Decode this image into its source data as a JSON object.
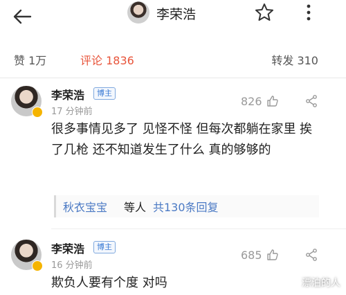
{
  "header": {
    "title": "李荣浩",
    "back_icon": "back-arrow-icon",
    "star_icon": "star-icon",
    "more_icon": "more-vertical-icon"
  },
  "stats": {
    "like_label": "赞 1万",
    "comment_label": "评论 1836",
    "repost_label": "转发 310"
  },
  "comments": [
    {
      "author": "李荣浩",
      "tag": "博主",
      "time": "17 分钟前",
      "likes": "826",
      "text": "很多事情见多了 见怪不怪 但每次都躺在家里 挨了几枪 还不知道发生了什么 真的够够的",
      "reply_user": "秋衣宝宝",
      "reply_mid": "等人",
      "reply_count": "共130条回复"
    },
    {
      "author": "李荣浩",
      "tag": "博主",
      "time": "16 分钟前",
      "likes": "685",
      "text": "欺负人要有个度 对吗"
    }
  ],
  "watermark": "漂泊的人",
  "colors": {
    "accent": "#e8543a",
    "link": "#4a79c4",
    "verified": "#f5b400"
  }
}
